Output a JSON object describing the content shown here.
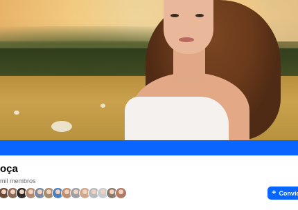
{
  "group": {
    "name": "oça",
    "members_text": "mil membros"
  },
  "invite_button": {
    "label": "Convidar",
    "icon": "plus-icon"
  },
  "colors": {
    "accent": "#0866ff",
    "text_primary": "#050505",
    "text_secondary": "#65676b"
  },
  "member_avatars": [
    {
      "color": "#6b4a3a"
    },
    {
      "color": "#8a6a58"
    },
    {
      "color": "#2e2a28"
    },
    {
      "color": "#b08a70"
    },
    {
      "color": "#7c8aa0"
    },
    {
      "color": "#a8896a"
    },
    {
      "color": "#4a7fc0"
    },
    {
      "color": "#c08e70"
    },
    {
      "color": "#9aa0a6"
    },
    {
      "color": "#d2a88c"
    },
    {
      "color": "#b7bcc2"
    },
    {
      "color": "#c7ccd1"
    },
    {
      "color": "#8a7a6e"
    },
    {
      "color": "#b07a64"
    }
  ]
}
